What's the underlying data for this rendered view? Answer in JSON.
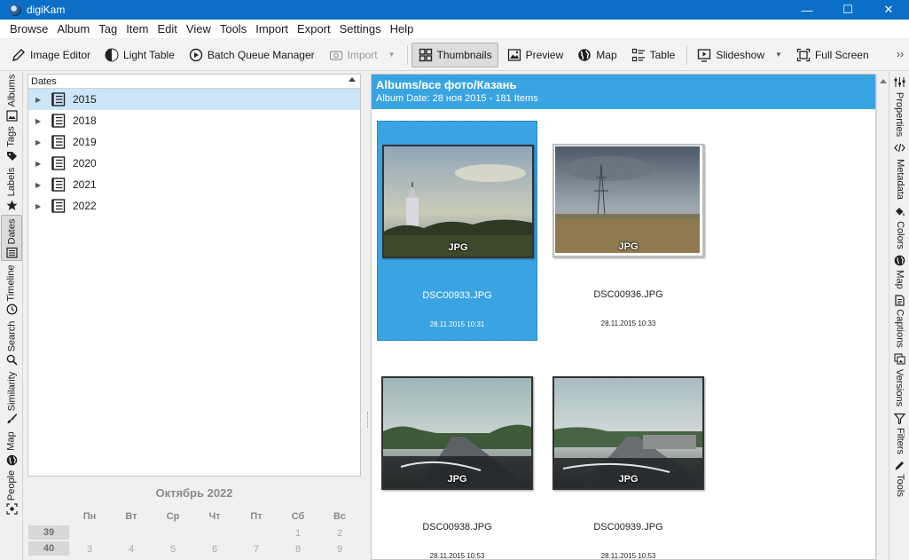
{
  "window": {
    "title": "digiKam",
    "controls": {
      "minimize": "—",
      "maximize": "☐",
      "close": "✕"
    }
  },
  "menu": [
    "Browse",
    "Album",
    "Tag",
    "Item",
    "Edit",
    "View",
    "Tools",
    "Import",
    "Export",
    "Settings",
    "Help"
  ],
  "toolbar": {
    "image_editor": "Image Editor",
    "light_table": "Light Table",
    "batch_queue": "Batch Queue Manager",
    "import": "Import",
    "thumbnails": "Thumbnails",
    "preview": "Preview",
    "map": "Map",
    "table": "Table",
    "slideshow": "Slideshow",
    "full_screen": "Full Screen",
    "more": "››",
    "active": "Thumbnails"
  },
  "left_tabs": [
    "Albums",
    "Tags",
    "Labels",
    "Dates",
    "Timeline",
    "Search",
    "Similarity",
    "Map",
    "People"
  ],
  "left_tabs_active": "Dates",
  "right_tabs": [
    "Properties",
    "Metadata",
    "Colors",
    "Map",
    "Captions",
    "Versions",
    "Filters",
    "Tools"
  ],
  "dates_panel": {
    "header": "Dates",
    "years": [
      "2015",
      "2018",
      "2019",
      "2020",
      "2021",
      "2022"
    ],
    "selected": "2015"
  },
  "calendar": {
    "month": "Октябрь 2022",
    "weekdays": [
      "Пн",
      "Вт",
      "Ср",
      "Чт",
      "Пт",
      "Сб",
      "Вс"
    ],
    "weeks": [
      {
        "number": "39",
        "days": [
          "",
          "",
          "",
          "",
          "",
          "1",
          "2"
        ]
      },
      {
        "number": "40",
        "days": [
          "3",
          "4",
          "5",
          "6",
          "7",
          "8",
          "9"
        ]
      }
    ]
  },
  "album": {
    "title": "Albums/все фото/Казань",
    "subtitle": "Album Date: 28 ноя 2015 - 181 Items"
  },
  "thumbnails": [
    {
      "name": "DSC00933.JPG",
      "date": "28.11.2015 10:31",
      "ext": "JPG",
      "selected": true
    },
    {
      "name": "DSC00936.JPG",
      "date": "28.11.2015 10:33",
      "ext": "JPG",
      "selected": false
    },
    {
      "name": "DSC00938.JPG",
      "date": "28.11.2015 10:53",
      "ext": "JPG",
      "selected": false
    },
    {
      "name": "DSC00939.JPG",
      "date": "28.11.2015 10:53",
      "ext": "JPG",
      "selected": false
    }
  ],
  "colors": {
    "accent": "#3aa4e3",
    "titlebar": "#0b6fc7",
    "tree_selection": "#cde6f7"
  }
}
